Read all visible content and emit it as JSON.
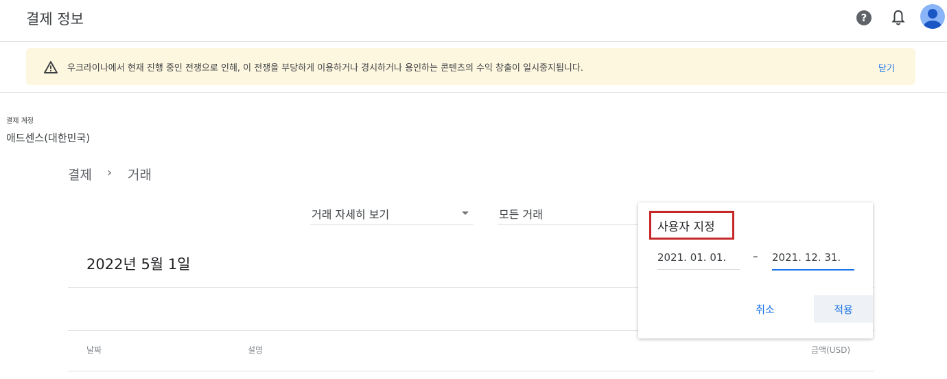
{
  "header": {
    "title": "결제 정보"
  },
  "banner": {
    "text": "우크라이나에서 현재 진행 중인 전쟁으로 인해, 이 전쟁을 부당하게 이용하거나 경시하거나 용인하는 콘텐츠의 수익 창출이 일시중지됩니다.",
    "close_label": "닫기"
  },
  "account": {
    "label": "결제 계정",
    "name": "애드센스(대한민국)"
  },
  "breadcrumb": {
    "parent": "결제",
    "current": "거래"
  },
  "filters": {
    "view_select": "거래 자세히 보기",
    "type_select": "모든 거래"
  },
  "content": {
    "date_heading": "2022년 5월 1일",
    "columns": {
      "date": "날짜",
      "description": "설명",
      "amount": "금액(USD)"
    }
  },
  "date_popup": {
    "title": "사용자 지정",
    "start_date": "2021. 01. 01.",
    "dash": "–",
    "end_date": "2021. 12. 31.",
    "cancel_label": "취소",
    "apply_label": "적용"
  },
  "colors": {
    "accent": "#1a73e8",
    "banner_bg": "#fef7e0",
    "highlight_border": "#c62828"
  }
}
